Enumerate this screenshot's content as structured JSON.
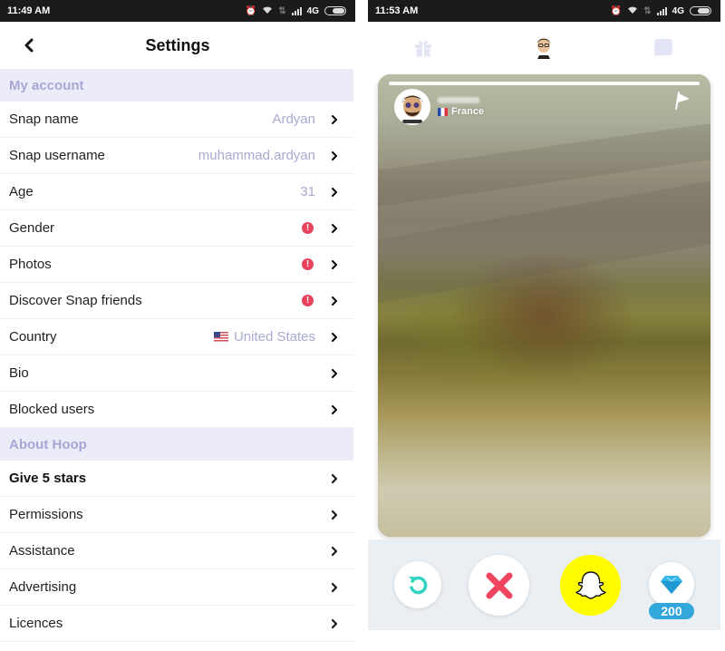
{
  "left_screen": {
    "status_bar": {
      "time": "11:49 AM",
      "network": "4G"
    },
    "header": {
      "title": "Settings",
      "back_icon": "chevron-left-icon"
    },
    "sections": [
      {
        "title": "My account",
        "rows": [
          {
            "label": "Snap name",
            "value": "Ardyan",
            "warning": false,
            "flag": ""
          },
          {
            "label": "Snap username",
            "value": "muhammad.ardyan",
            "warning": false,
            "flag": ""
          },
          {
            "label": "Age",
            "value": "31",
            "warning": false,
            "flag": ""
          },
          {
            "label": "Gender",
            "value": "",
            "warning": true,
            "flag": ""
          },
          {
            "label": "Photos",
            "value": "",
            "warning": true,
            "flag": ""
          },
          {
            "label": "Discover Snap friends",
            "value": "",
            "warning": true,
            "flag": ""
          },
          {
            "label": "Country",
            "value": "United States",
            "warning": false,
            "flag": "us"
          },
          {
            "label": "Bio",
            "value": "",
            "warning": false,
            "flag": ""
          },
          {
            "label": "Blocked users",
            "value": "",
            "warning": false,
            "flag": ""
          }
        ]
      },
      {
        "title": "About Hoop",
        "rows": [
          {
            "label": "Give 5 stars",
            "value": "",
            "warning": false,
            "flag": "",
            "bold": true
          },
          {
            "label": "Permissions",
            "value": "",
            "warning": false,
            "flag": ""
          },
          {
            "label": "Assistance",
            "value": "",
            "warning": false,
            "flag": ""
          },
          {
            "label": "Advertising",
            "value": "",
            "warning": false,
            "flag": ""
          },
          {
            "label": "Licences",
            "value": "",
            "warning": false,
            "flag": ""
          }
        ]
      }
    ],
    "warning_glyph": "!"
  },
  "right_screen": {
    "status_bar": {
      "time": "11:53 AM",
      "network": "4G"
    },
    "top_nav": {
      "left_icon": "gift-icon",
      "center_icon": "bitmoji-avatar-icon",
      "right_icon": "chat-bubble-icon"
    },
    "profile_card": {
      "country": "France",
      "country_flag": "fr",
      "username_blurred": true,
      "report_icon": "flag-icon"
    },
    "actions": {
      "rewind_icon": "rewind-icon",
      "nope_icon": "x-icon",
      "snap_icon": "snapchat-ghost-icon",
      "gems_icon": "diamond-icon",
      "gem_count": "200"
    }
  },
  "colors": {
    "section_bg": "#ececf8",
    "section_text": "#a7a7d6",
    "value_text": "#a9a9d2",
    "warning": "#e8435e",
    "rewind": "#2fd3c0",
    "nope": "#ef4560",
    "snap_yellow": "#fffc00",
    "gem_blue": "#31a7dc"
  }
}
